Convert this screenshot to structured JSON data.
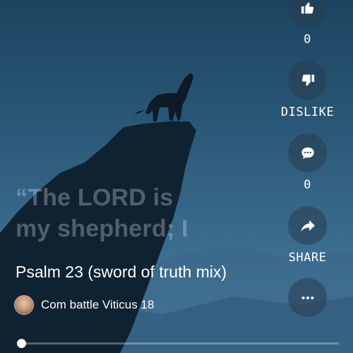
{
  "video": {
    "title": "Psalm 23 (sword of truth mix)",
    "channel": "Com battle Viticus 18",
    "quote_line1": "“The LORD is",
    "quote_line2": "my shepherd; I",
    "progress": 0.0
  },
  "actions": {
    "like_count": "0",
    "dislike_label": "DISLIKE",
    "comment_count": "0",
    "share_label": "SHARE"
  },
  "icons": {
    "like": "thumbs-up-icon",
    "dislike": "thumbs-down-icon",
    "comment": "comment-icon",
    "share": "share-arrow-icon",
    "more": "more-dots-icon"
  },
  "colors": {
    "sky_top": "#1c4460",
    "sky_bottom": "#4d84a6",
    "silhouette": "#0f2232"
  }
}
